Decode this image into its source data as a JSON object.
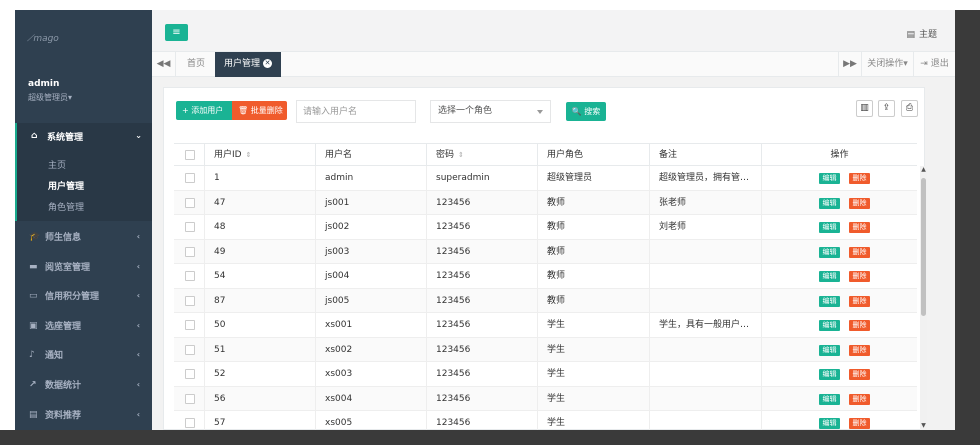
{
  "sidebar": {
    "logo_text": "mago",
    "user_name": "admin",
    "user_role": "超级管理员▾",
    "open_menu": {
      "label": "系统管理",
      "items": [
        {
          "label": "主页"
        },
        {
          "label": "用户管理"
        },
        {
          "label": "角色管理"
        }
      ]
    },
    "menu_items": [
      {
        "label": "师生信息"
      },
      {
        "label": "阅览室管理"
      },
      {
        "label": "信用积分管理"
      },
      {
        "label": "选座管理"
      },
      {
        "label": "通知"
      },
      {
        "label": "数据统计"
      },
      {
        "label": "资料推荐"
      }
    ]
  },
  "header": {
    "theme_label": "主题"
  },
  "tabs": {
    "home_label": "首页",
    "active_label": "用户管理",
    "ops_label": "关闭操作▾",
    "exit_label": "退出"
  },
  "toolbar": {
    "add_label": "添加用户",
    "batch_delete_label": "批量删除",
    "username_placeholder": "请输入用户名",
    "role_placeholder": "选择一个角色",
    "search_label": "搜索"
  },
  "table": {
    "headers": {
      "user_id": "用户ID",
      "username": "用户名",
      "password": "密码",
      "role": "用户角色",
      "remark": "备注",
      "actions": "操作"
    },
    "edit_label": "编辑",
    "delete_label": "删除",
    "rows": [
      {
        "id": "1",
        "username": "admin",
        "password": "superadmin",
        "role": "超级管理员",
        "remark": "超级管理员，拥有管…"
      },
      {
        "id": "47",
        "username": "js001",
        "password": "123456",
        "role": "教师",
        "remark": "张老师"
      },
      {
        "id": "48",
        "username": "js002",
        "password": "123456",
        "role": "教师",
        "remark": "刘老师"
      },
      {
        "id": "49",
        "username": "js003",
        "password": "123456",
        "role": "教师",
        "remark": ""
      },
      {
        "id": "54",
        "username": "js004",
        "password": "123456",
        "role": "教师",
        "remark": ""
      },
      {
        "id": "87",
        "username": "js005",
        "password": "123456",
        "role": "教师",
        "remark": ""
      },
      {
        "id": "50",
        "username": "xs001",
        "password": "123456",
        "role": "学生",
        "remark": "学生，具有一般用户…"
      },
      {
        "id": "51",
        "username": "xs002",
        "password": "123456",
        "role": "学生",
        "remark": ""
      },
      {
        "id": "52",
        "username": "xs003",
        "password": "123456",
        "role": "学生",
        "remark": ""
      },
      {
        "id": "56",
        "username": "xs004",
        "password": "123456",
        "role": "学生",
        "remark": ""
      },
      {
        "id": "57",
        "username": "xs005",
        "password": "123456",
        "role": "学生",
        "remark": ""
      }
    ]
  },
  "colors": {
    "sidebar_bg": "#2f4050",
    "accent_green": "#1ab394",
    "danger_orange": "#f05b2c"
  }
}
